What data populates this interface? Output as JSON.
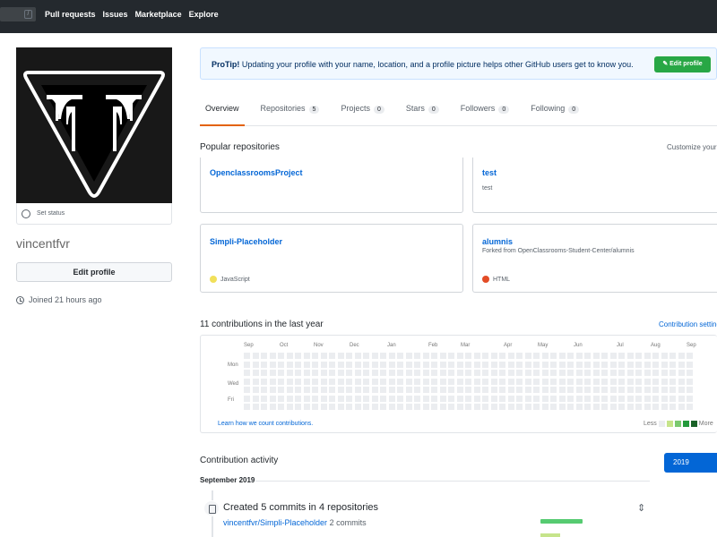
{
  "header": {
    "search_shortcut": "/",
    "nav": [
      "Pull requests",
      "Issues",
      "Marketplace",
      "Explore"
    ]
  },
  "profile": {
    "set_status": "Set status",
    "username": "vincentfvr",
    "edit_profile": "Edit profile",
    "joined": "Joined 21 hours ago"
  },
  "protip": {
    "label": "ProTip!",
    "text": "Updating your profile with your name, location, and a profile picture helps other GitHub users get to know you.",
    "button": "Edit profile"
  },
  "tabs": [
    {
      "label": "Overview",
      "count": ""
    },
    {
      "label": "Repositories",
      "count": "5"
    },
    {
      "label": "Projects",
      "count": "0"
    },
    {
      "label": "Stars",
      "count": "0"
    },
    {
      "label": "Followers",
      "count": "0"
    },
    {
      "label": "Following",
      "count": "0"
    }
  ],
  "popular": {
    "title": "Popular repositories",
    "customize": "Customize your pins",
    "repos": [
      {
        "name": "OpenclassroomsProject",
        "desc": "",
        "lang": "",
        "lang_color": ""
      },
      {
        "name": "test",
        "desc": "test",
        "lang": "",
        "lang_color": ""
      },
      {
        "name": "Simpli-Placeholder",
        "desc": "",
        "lang": "JavaScript",
        "lang_color": "#f1e05a"
      },
      {
        "name": "alumnis",
        "desc": "Forked from OpenClassrooms-Student-Center/alumnis",
        "lang": "HTML",
        "lang_color": "#e34c26"
      }
    ]
  },
  "contributions": {
    "title": "11 contributions in the last year",
    "settings": "Contribution settings",
    "months": [
      "Sep",
      "Oct",
      "Nov",
      "Dec",
      "Jan",
      "Feb",
      "Mar",
      "Apr",
      "May",
      "Jun",
      "Jul",
      "Aug",
      "Sep"
    ],
    "day_labels": [
      "Mon",
      "Wed",
      "Fri"
    ],
    "learn_link": "Learn how we count contributions.",
    "less": "Less",
    "more": "More",
    "legend_colors": [
      "#ebedf0",
      "#c6e48b",
      "#7bc96f",
      "#239a3b",
      "#196127"
    ]
  },
  "activity": {
    "title": "Contribution activity",
    "year": "2019",
    "month": "September 2019",
    "commit_title": "Created 5 commits in 4 repositories",
    "commit_repo": "vincentfvr/Simpli-Placeholder",
    "commit_count": "2 commits"
  }
}
